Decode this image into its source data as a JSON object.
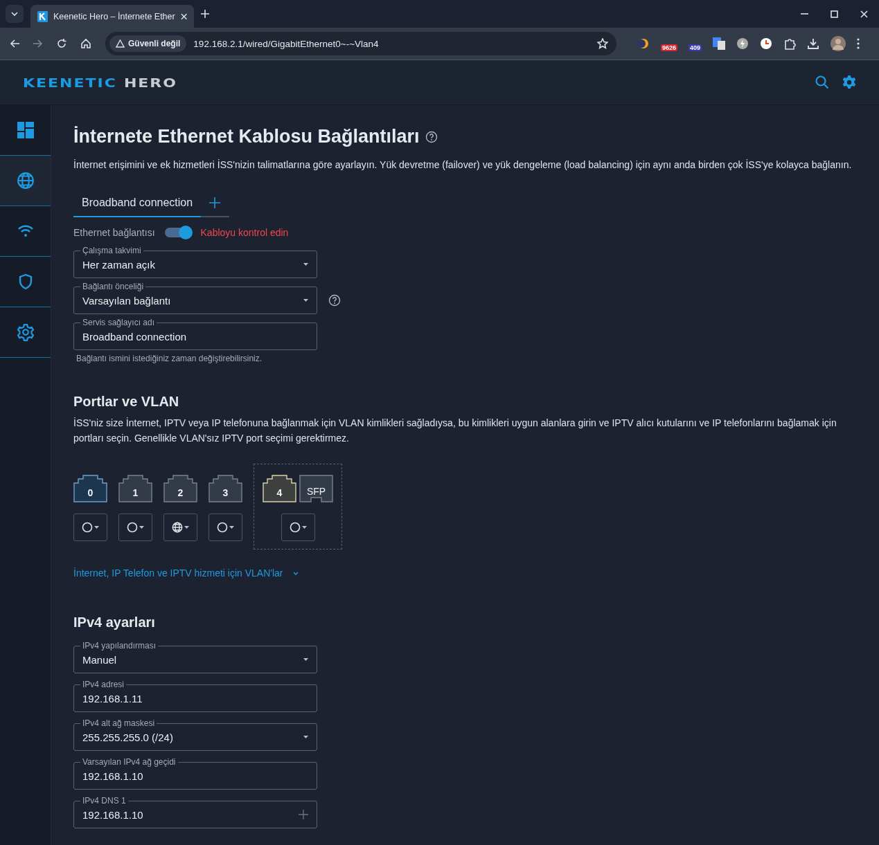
{
  "browser": {
    "tab_title": "Keenetic Hero – İnternete Ether",
    "security": "Güvenli değil",
    "url": "192.168.2.1/wired/GigabitEthernet0~-~Vlan4",
    "badges": [
      "9626",
      "409"
    ]
  },
  "header": {
    "brand": "KEENETIC",
    "model": "HERO"
  },
  "sidebar": {
    "items": [
      {
        "kind": "dashboard",
        "selected": false
      },
      {
        "kind": "globe",
        "selected": true
      },
      {
        "kind": "wifi",
        "selected": false
      },
      {
        "kind": "shield",
        "selected": false
      },
      {
        "kind": "gear",
        "selected": false
      }
    ]
  },
  "page": {
    "title": "İnternete Ethernet Kablosu Bağlantıları",
    "description": "İnternet erişimini ve ek hizmetleri İSS'nizin talimatlarına göre ayarlayın. Yük devretme (failover) ve yük dengeleme (load balancing) için aynı anda birden çok İSS'ye kolayca bağlanın.",
    "tabs": [
      {
        "label": "Broadband connection",
        "selected": true
      }
    ],
    "ethernet": {
      "label": "Ethernet bağlantısı",
      "on": true,
      "status": "Kabloyu kontrol edin"
    },
    "fields": [
      {
        "kind": "select",
        "label": "Çalışma takvimi",
        "value": "Her zaman açık"
      },
      {
        "kind": "select",
        "label": "Bağlantı önceliği",
        "value": "Varsayılan bağlantı",
        "help": true
      },
      {
        "kind": "input",
        "label": "Servis sağlayıcı adı",
        "value": "Broadband connection",
        "hint": "Bağlantı ismini istediğiniz zaman değiştirebilirsiniz."
      }
    ]
  },
  "ports_section": {
    "title": "Portlar ve VLAN",
    "description": "İSS'niz size İnternet, IPTV veya IP telefonuna bağlanmak için VLAN kimlikleri sağladıysa, bu kimlikleri uygun alanlara girin ve IPTV alıcı kutularını ve IP telefonlarını bağlamak için portları seçin. Genellikle VLAN'sız IPTV port seçimi gerektirmez.",
    "groups": [
      {
        "internet": false,
        "ports": [
          {
            "kind": "rj45",
            "label": "0",
            "connected": true,
            "highlighted": false
          }
        ]
      },
      {
        "internet": false,
        "ports": [
          {
            "kind": "rj45",
            "label": "1",
            "connected": false,
            "highlighted": false
          }
        ]
      },
      {
        "internet": true,
        "ports": [
          {
            "kind": "rj45",
            "label": "2",
            "connected": false,
            "highlighted": false
          }
        ]
      },
      {
        "internet": false,
        "ports": [
          {
            "kind": "rj45",
            "label": "3",
            "connected": false,
            "highlighted": false
          }
        ]
      },
      {
        "internet": false,
        "ports": [
          {
            "kind": "rj45",
            "label": "4",
            "connected": false,
            "highlighted": true
          },
          {
            "kind": "sfp",
            "label": "SFP",
            "connected": false,
            "highlighted": false
          }
        ]
      }
    ],
    "vlan_link": "İnternet, IP Telefon ve IPTV hizmeti için VLAN'lar"
  },
  "ipv4": {
    "title": "IPv4 ayarları",
    "fields": [
      {
        "kind": "select",
        "label": "IPv4 yapılandırması",
        "value": "Manuel"
      },
      {
        "kind": "input",
        "label": "IPv4 adresi",
        "value": "192.168.1.11"
      },
      {
        "kind": "select",
        "label": "IPv4 alt ağ maskesi",
        "value": "255.255.255.0 (/24)"
      },
      {
        "kind": "input",
        "label": "Varsayılan IPv4 ağ geçidi",
        "value": "192.168.1.10"
      },
      {
        "kind": "add",
        "label": "IPv4 DNS 1",
        "value": "192.168.1.10"
      }
    ]
  }
}
